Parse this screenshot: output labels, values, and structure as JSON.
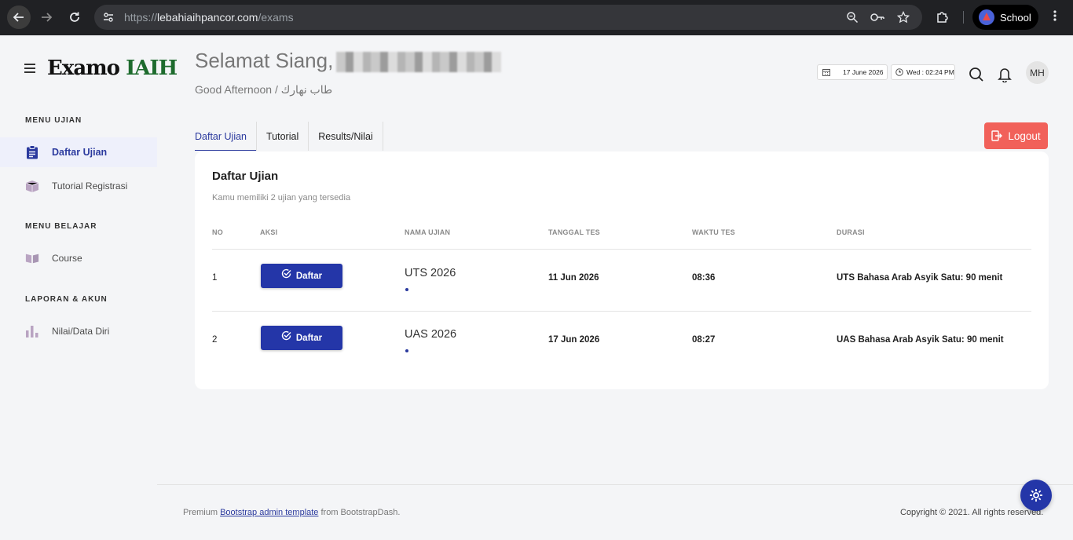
{
  "browser": {
    "url_scheme": "https://",
    "url_host": "lebahiaihpancor.com",
    "url_path": "/exams",
    "profile_label": "School"
  },
  "sidebar": {
    "brand_part1": "Examo",
    "brand_part2": "IAIH",
    "sections": [
      {
        "title": "MENU UJIAN",
        "items": [
          {
            "label": "Daftar Ujian",
            "icon": "clipboard-icon",
            "active": true
          },
          {
            "label": "Tutorial Registrasi",
            "icon": "box-icon",
            "active": false
          }
        ]
      },
      {
        "title": "MENU BELAJAR",
        "items": [
          {
            "label": "Course",
            "icon": "book-icon",
            "active": false
          }
        ]
      },
      {
        "title": "LAPORAN & AKUN",
        "items": [
          {
            "label": "Nilai/Data Diri",
            "icon": "bar-chart-icon",
            "active": false
          }
        ]
      }
    ]
  },
  "header": {
    "greeting": "Selamat Siang,",
    "subtitle": "Good Afternoon / طاب نهارك",
    "date": "17 June 2026",
    "time": "Wed : 02:24 PM",
    "avatar_initials": "MH"
  },
  "tabs": [
    "Daftar Ujian",
    "Tutorial",
    "Results/Nilai"
  ],
  "logout_label": "Logout",
  "card": {
    "title": "Daftar Ujian",
    "description": "Kamu memiliki 2 ujian yang tersedia",
    "columns": [
      "NO",
      "AKSI",
      "NAMA UJIAN",
      "TANGGAL TES",
      "WAKTU TES",
      "DURASI"
    ],
    "rows": [
      {
        "no": "1",
        "action": "Daftar",
        "name": "UTS 2026",
        "date": "11 Jun 2026",
        "time": "08:36",
        "duration": "UTS Bahasa Arab Asyik Satu: 90 menit"
      },
      {
        "no": "2",
        "action": "Daftar",
        "name": "UAS 2026",
        "date": "17 Jun 2026",
        "time": "08:27",
        "duration": "UAS Bahasa Arab Asyik Satu: 90 menit"
      }
    ]
  },
  "footer": {
    "prefix": "Premium",
    "link": "Bootstrap admin template",
    "suffix": "from BootstrapDash.",
    "copyright": "Copyright © 2021. All rights reserved."
  },
  "colors": {
    "primary": "#2436a8",
    "logout": "#f1615a",
    "brand_green": "#1d6b2d"
  }
}
